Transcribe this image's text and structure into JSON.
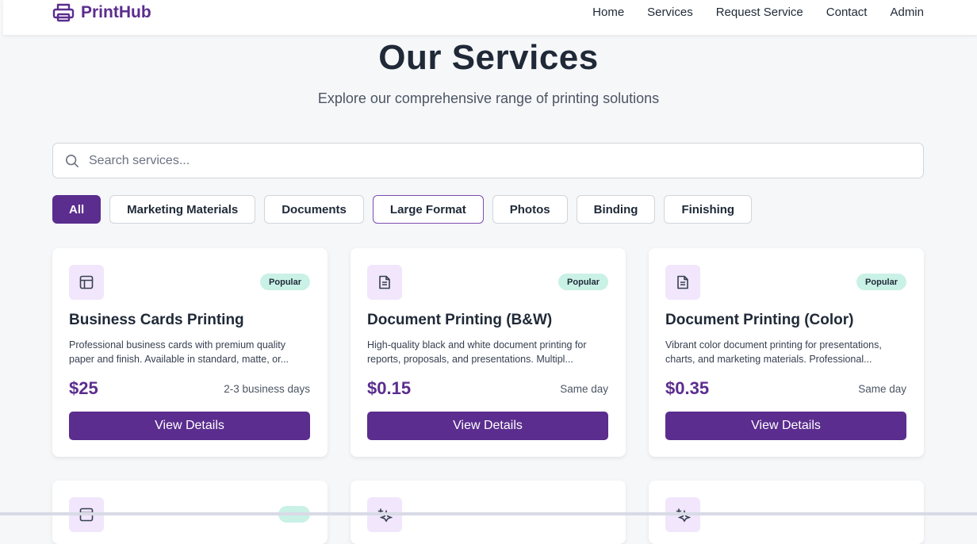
{
  "brand": {
    "name": "PrintHub",
    "icon": "printer-icon"
  },
  "nav": {
    "items": [
      "Home",
      "Services",
      "Request Service",
      "Contact",
      "Admin"
    ]
  },
  "hero": {
    "title": "Our Services",
    "subtitle": "Explore our comprehensive range of printing solutions"
  },
  "search": {
    "placeholder": "Search services...",
    "value": "",
    "icon": "search-icon"
  },
  "filters": {
    "active": "All",
    "items": [
      "All",
      "Marketing Materials",
      "Documents",
      "Large Format",
      "Photos",
      "Binding",
      "Finishing"
    ]
  },
  "services": [
    {
      "icon": "layout-icon",
      "badge": "Popular",
      "title": "Business Cards Printing",
      "description": "Professional business cards with premium quality paper and finish. Available in standard, matte, or...",
      "price": "$25",
      "turnaround": "2-3 business days",
      "button": "View Details"
    },
    {
      "icon": "document-icon",
      "badge": "Popular",
      "title": "Document Printing (B&W)",
      "description": "High-quality black and white document printing for reports, proposals, and presentations. Multipl...",
      "price": "$0.15",
      "turnaround": "Same day",
      "button": "View Details"
    },
    {
      "icon": "document-icon",
      "badge": "Popular",
      "title": "Document Printing (Color)",
      "description": "Vibrant color document printing for presentations, charts, and marketing materials. Professional...",
      "price": "$0.35",
      "turnaround": "Same day",
      "button": "View Details"
    }
  ],
  "colors": {
    "brand": "#5b2d8e",
    "badge_bg": "#c9f1e6",
    "icon_bg": "#f1e6fb",
    "page_bg": "#f6f7f9"
  }
}
